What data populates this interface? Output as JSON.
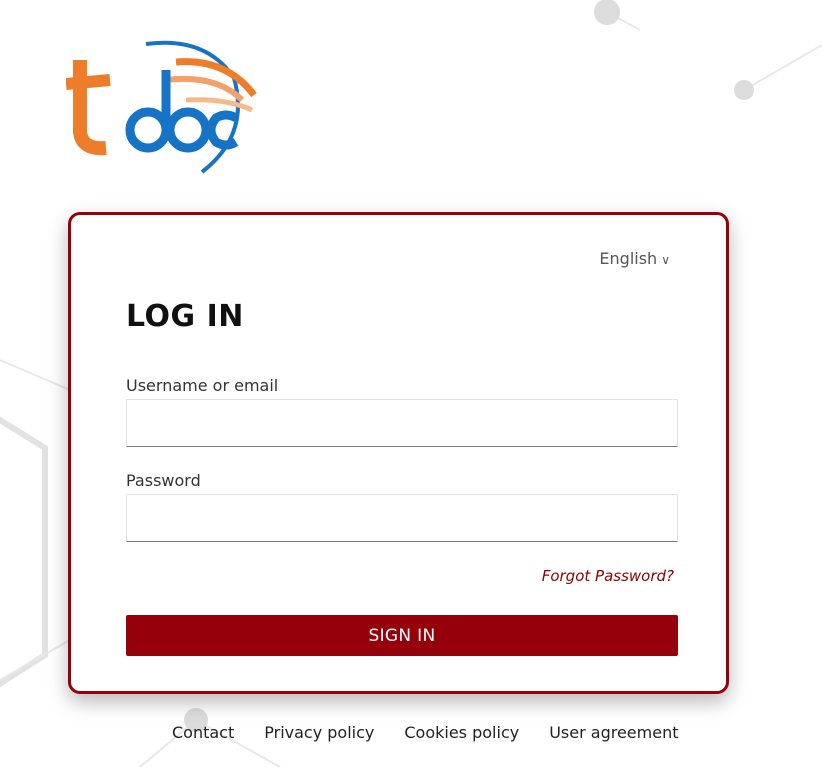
{
  "login": {
    "language": "English",
    "title": "LOG IN",
    "username_label": "Username or email",
    "username_value": "",
    "password_label": "Password",
    "password_value": "",
    "forgot_password": "Forgot Password?",
    "sign_in": "SIGN IN"
  },
  "footer": {
    "contact": "Contact",
    "privacy": "Privacy policy",
    "cookies": "Cookies policy",
    "agreement": "User agreement"
  },
  "colors": {
    "accent": "#96000a",
    "logo_orange": "#ee7d2b",
    "logo_blue": "#1673c6"
  },
  "icons": [
    "chevron-down-icon"
  ]
}
